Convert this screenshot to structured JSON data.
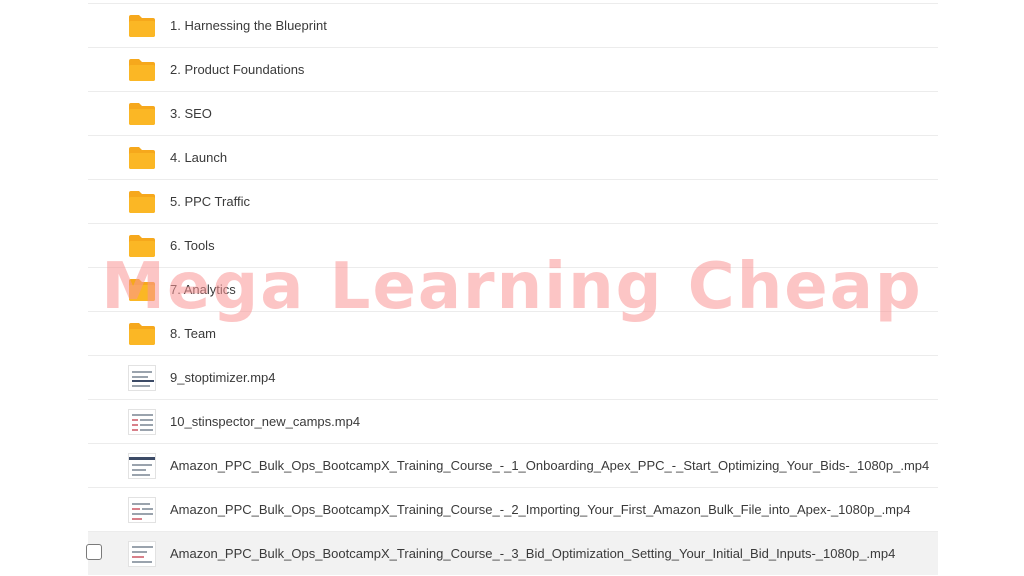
{
  "files": [
    {
      "name": "1. Harnessing the Blueprint",
      "type": "folder"
    },
    {
      "name": "2. Product Foundations",
      "type": "folder"
    },
    {
      "name": "3. SEO",
      "type": "folder"
    },
    {
      "name": "4. Launch",
      "type": "folder"
    },
    {
      "name": "5. PPC Traffic",
      "type": "folder"
    },
    {
      "name": "6. Tools",
      "type": "folder"
    },
    {
      "name": "7. Analytics",
      "type": "folder"
    },
    {
      "name": "8. Team",
      "type": "folder"
    },
    {
      "name": "9_stoptimizer.mp4",
      "type": "video"
    },
    {
      "name": "10_stinspector_new_camps.mp4",
      "type": "video"
    },
    {
      "name": "Amazon_PPC_Bulk_Ops_BootcampX_Training_Course_-_1_Onboarding_Apex_PPC_-_Start_Optimizing_Your_Bids-_1080p_.mp4",
      "type": "video"
    },
    {
      "name": "Amazon_PPC_Bulk_Ops_BootcampX_Training_Course_-_2_Importing_Your_First_Amazon_Bulk_File_into_Apex-_1080p_.mp4",
      "type": "video"
    },
    {
      "name": "Amazon_PPC_Bulk_Ops_BootcampX_Training_Course_-_3_Bid_Optimization_Setting_Your_Initial_Bid_Inputs-_1080p_.mp4",
      "type": "video"
    }
  ],
  "watermark": "Mega Learning Cheap",
  "colors": {
    "folder": "#fbb725",
    "folder_tab": "#f6a81c",
    "watermark": "#fa9696"
  }
}
